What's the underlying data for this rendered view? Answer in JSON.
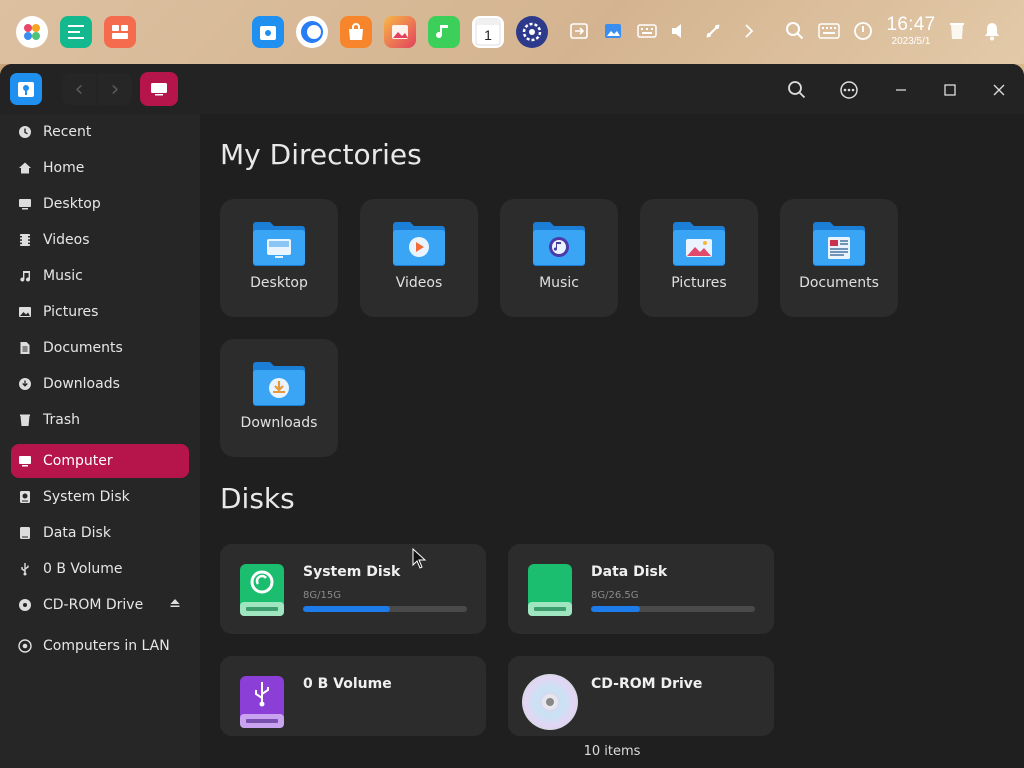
{
  "dock": {
    "apps": [
      {
        "name": "launcher-icon"
      },
      {
        "name": "deepin-editor-icon"
      },
      {
        "name": "multitasking-icon"
      },
      {
        "name": "file-manager-icon"
      },
      {
        "name": "browser-icon"
      },
      {
        "name": "app-store-icon"
      },
      {
        "name": "image-viewer-icon"
      },
      {
        "name": "music-player-icon"
      },
      {
        "name": "calendar-icon",
        "text": "1"
      },
      {
        "name": "settings-icon"
      }
    ],
    "clock": {
      "time": "16:47",
      "date": "2023/5/1"
    }
  },
  "window": {
    "nav_back": "‹",
    "nav_forward": "›"
  },
  "sidebar": {
    "items": [
      {
        "label": "Recent"
      },
      {
        "label": "Home"
      },
      {
        "label": "Desktop"
      },
      {
        "label": "Videos"
      },
      {
        "label": "Music"
      },
      {
        "label": "Pictures"
      },
      {
        "label": "Documents"
      },
      {
        "label": "Downloads"
      },
      {
        "label": "Trash"
      },
      {
        "label": "Computer"
      },
      {
        "label": "System Disk"
      },
      {
        "label": "Data Disk"
      },
      {
        "label": "0 B Volume"
      },
      {
        "label": "CD-ROM Drive"
      },
      {
        "label": "Computers in LAN"
      }
    ]
  },
  "main": {
    "directories_title": "My Directories",
    "directories": [
      {
        "label": "Desktop"
      },
      {
        "label": "Videos"
      },
      {
        "label": "Music"
      },
      {
        "label": "Pictures"
      },
      {
        "label": "Documents"
      },
      {
        "label": "Downloads"
      }
    ],
    "disks_title": "Disks",
    "disks": [
      {
        "name": "System Disk",
        "size": "8G/15G",
        "usage": 0.53
      },
      {
        "name": "Data Disk",
        "size": "8G/26.5G",
        "usage": 0.3
      },
      {
        "name": "0 B Volume",
        "size": ""
      },
      {
        "name": "CD-ROM Drive",
        "size": ""
      }
    ]
  },
  "status": {
    "text": "10 items"
  },
  "colors": {
    "accent": "#b5154b",
    "progress": "#1e7bea"
  }
}
